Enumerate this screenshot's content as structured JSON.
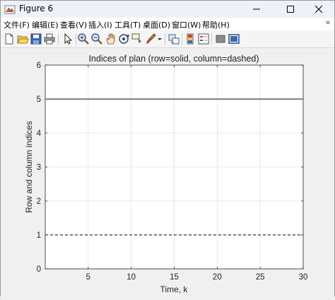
{
  "window": {
    "title": "Figure 6",
    "controls": [
      "minimize",
      "maximize",
      "close"
    ]
  },
  "menu": {
    "items": [
      "文件(F)",
      "编辑(E)",
      "查看(V)",
      "插入(I)",
      "工具(T)",
      "桌面(D)",
      "窗口(W)",
      "帮助(H)"
    ],
    "overflow": "»"
  },
  "toolbar": {
    "buttons": [
      "new-figure-icon",
      "open-file-icon",
      "save-icon",
      "print-icon",
      "pointer-icon",
      "zoom-in-icon",
      "zoom-out-icon",
      "pan-icon",
      "rotate-3d-icon",
      "data-cursor-icon",
      "brush-icon",
      "brush-dropdown-icon",
      "link-plot-icon",
      "colorbar-icon",
      "legend-icon",
      "hide-plot-tools-icon",
      "show-plot-tools-icon"
    ]
  },
  "chart_data": {
    "type": "line",
    "title": "Indices of plan (row=solid, column=dashed)",
    "xlabel": "Time, k",
    "ylabel": "Row and column indices",
    "xlim": [
      0,
      30
    ],
    "ylim": [
      0,
      6
    ],
    "xticks": [
      5,
      10,
      15,
      20,
      25,
      30
    ],
    "yticks": [
      0,
      1,
      2,
      3,
      4,
      5,
      6
    ],
    "grid": true,
    "series": [
      {
        "name": "row",
        "style": "solid",
        "color": "#000000",
        "x": [
          0,
          30
        ],
        "y": [
          5,
          5
        ]
      },
      {
        "name": "column",
        "style": "dashed",
        "color": "#000000",
        "x": [
          0,
          30
        ],
        "y": [
          1,
          1
        ]
      }
    ]
  }
}
